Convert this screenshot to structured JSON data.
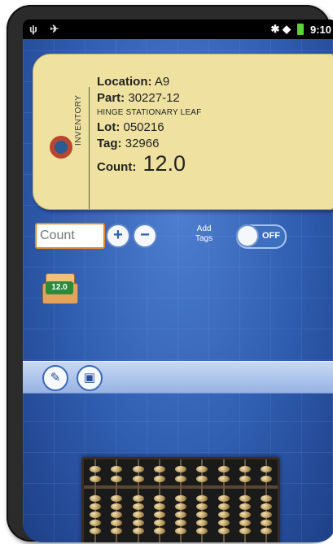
{
  "statusbar": {
    "left_icons": "ψ ✈",
    "right_icons": "✱ ◆",
    "time": "9:10"
  },
  "tag": {
    "side_label": "INVENTORY",
    "location_label": "Location:",
    "location": "A9",
    "part_label": "Part:",
    "part": "30227-12",
    "description": "HINGE STATIONARY LEAF",
    "lot_label": "Lot:",
    "lot": "050216",
    "tag_label": "Tag:",
    "tag": "32966",
    "count_label": "Count:",
    "count": "12.0"
  },
  "controls": {
    "count_placeholder": "Count",
    "plus": "+",
    "minus": "−",
    "add_tags_label_1": "Add",
    "add_tags_label_2": "Tags",
    "toggle_state": "OFF"
  },
  "box": {
    "count": "12.0"
  },
  "toolbar": {
    "edit_icon": "pencil-eraser-icon",
    "save_icon": "floppy-save-icon"
  },
  "colors": {
    "accent_orange": "#e88a2a",
    "tag_paper": "#efe2a1",
    "background_blue": "#2e57a6",
    "box_green": "#2c8a3b"
  }
}
